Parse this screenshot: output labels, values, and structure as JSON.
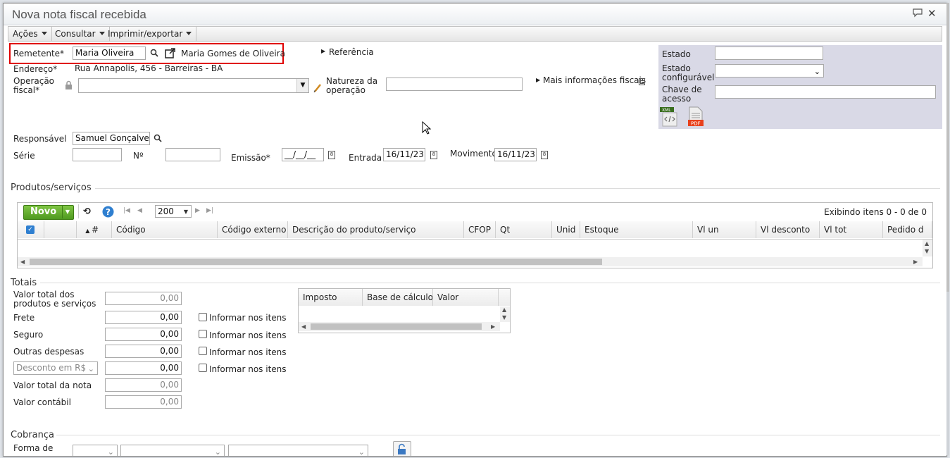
{
  "window": {
    "title": "Nova nota fiscal recebida"
  },
  "menus": [
    {
      "label": "Ações"
    },
    {
      "label": "Consultar"
    },
    {
      "label": "Imprimir/exportar"
    }
  ],
  "header": {
    "remetente_label": "Remetente*",
    "remetente_value": "Maria Oliveira",
    "remetente_link": "Maria Gomes de Oliveira",
    "referencia": "Referência",
    "endereco_label": "Endereço*",
    "endereco_value": "Rua Annapolis, 456 - Barreiras - BA",
    "operacao_label_1": "Operação",
    "operacao_label_2": "fiscal*",
    "natureza_label_1": "Natureza da",
    "natureza_label_2": "operação",
    "mais_info": "Mais informações fiscais",
    "responsavel_label": "Responsável",
    "responsavel_value": "Samuel Gonçalves",
    "serie_label": "Série",
    "numero_label": "Nº",
    "emissao_label": "Emissão*",
    "emissao_value": "__/__/__",
    "entrada_label": "Entrada",
    "entrada_value": "16/11/23",
    "movimento_label": "Movimento",
    "movimento_value": "16/11/23"
  },
  "status_panel": {
    "estado_label": "Estado",
    "estado_config_label_1": "Estado",
    "estado_config_label_2": "configurável",
    "chave_label_1": "Chave de",
    "chave_label_2": "acesso",
    "xml_icon_text": "XML",
    "pdf_icon_text": "PDF"
  },
  "produtos": {
    "section_title": "Produtos/serviços",
    "novo_label": "Novo",
    "page_size": "200",
    "exibindo": "Exibindo itens 0 - 0 de 0",
    "columns": [
      "#",
      "Código",
      "Código externo",
      "Descrição do produto/serviço",
      "CFOP",
      "Qt",
      "Unid",
      "Estoque",
      "Vl un",
      "Vl desconto",
      "Vl tot",
      "Pedido d"
    ]
  },
  "totais": {
    "section_title": "Totais",
    "valor_total_label_1": "Valor total dos",
    "valor_total_label_2": "produtos e serviços",
    "valor_total": "0,00",
    "frete_label": "Frete",
    "frete": "0,00",
    "seguro_label": "Seguro",
    "seguro": "0,00",
    "outras_label": "Outras despesas",
    "outras": "0,00",
    "desconto_select": "Desconto em R$",
    "desconto": "0,00",
    "valor_nota_label": "Valor total da nota",
    "valor_nota": "0,00",
    "valor_contabil_label": "Valor contábil",
    "valor_contabil": "0,00",
    "informar_label": "Informar nos itens",
    "impostos_columns": [
      "Imposto",
      "Base de cálculo",
      "Valor"
    ]
  },
  "cobranca": {
    "section_title": "Cobrança",
    "forma_label": "Forma de"
  },
  "colors": {
    "accent_green": "#5aa82a",
    "highlight_red": "#e00000",
    "panel_gray": "#d9d9e6"
  }
}
